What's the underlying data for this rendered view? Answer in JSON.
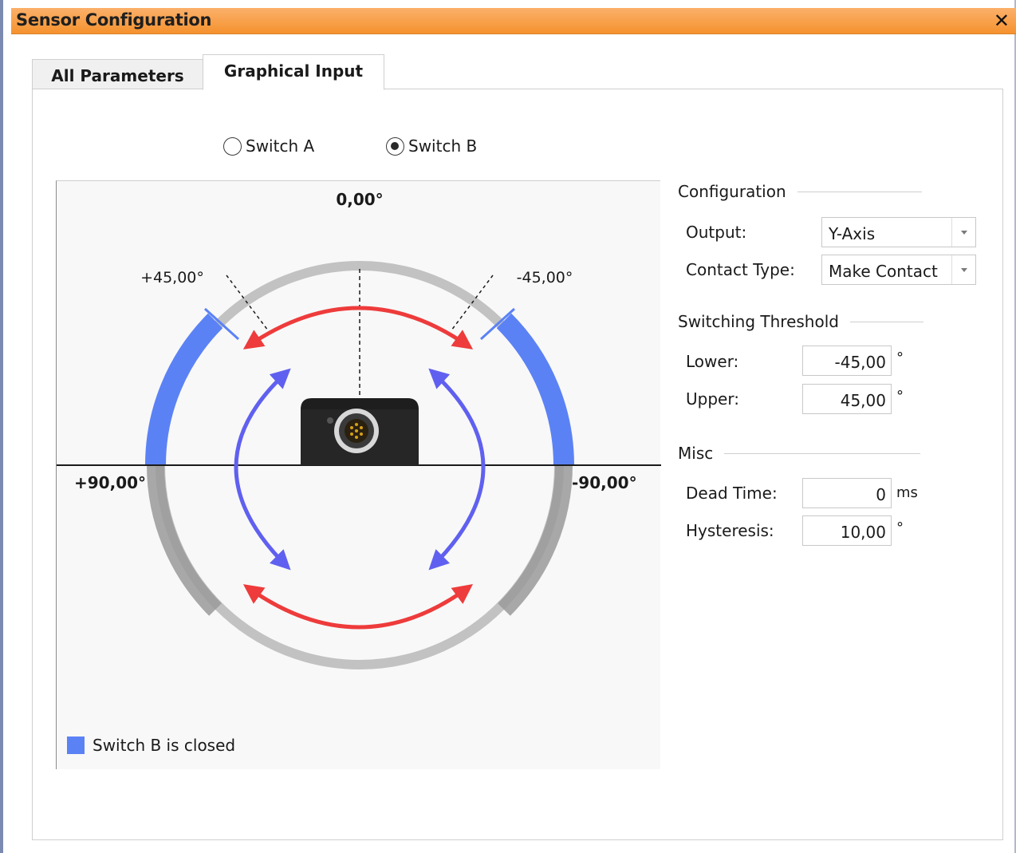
{
  "window": {
    "title": "Sensor Configuration",
    "close_glyph": "✕"
  },
  "tabs": [
    {
      "label": "All Parameters"
    },
    {
      "label": "Graphical Input",
      "active": true
    }
  ],
  "switch_select": {
    "options": [
      "Switch A",
      "Switch B"
    ],
    "selected": "Switch B"
  },
  "diagram": {
    "angle_top": "0,00°",
    "angle_left_upper": "+45,00°",
    "angle_right_upper": "-45,00°",
    "angle_left": "+90,00°",
    "angle_right": "-90,00°",
    "legend_label": "Switch B is closed",
    "legend_color": "#5b82f5",
    "closed_arc_color": "#5b82f5",
    "tilt_arrow_color": "#ee3b3b",
    "roll_arrow_color": "#6060f0"
  },
  "configuration": {
    "heading": "Configuration",
    "output_label": "Output:",
    "output_value": "Y-Axis",
    "contact_type_label": "Contact Type:",
    "contact_type_value": "Make Contact"
  },
  "threshold": {
    "heading": "Switching Threshold",
    "lower_label": "Lower:",
    "lower_value": "-45,00",
    "lower_unit": "°",
    "upper_label": "Upper:",
    "upper_value": "45,00",
    "upper_unit": "°"
  },
  "misc": {
    "heading": "Misc",
    "dead_time_label": "Dead Time:",
    "dead_time_value": "0",
    "dead_time_unit": "ms",
    "hysteresis_label": "Hysteresis:",
    "hysteresis_value": "10,00",
    "hysteresis_unit": "°"
  }
}
